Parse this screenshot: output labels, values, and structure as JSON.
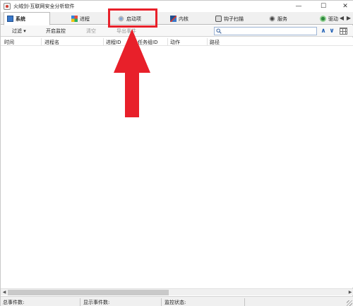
{
  "window": {
    "title": "火绒剑-互联网安全分析软件",
    "minimize": "—",
    "maximize": "☐",
    "close": "✕"
  },
  "tabs": [
    {
      "label": "系统",
      "icon": "monitor-icon",
      "active": true
    },
    {
      "label": "进程",
      "icon": "windows-flag-icon",
      "active": false
    },
    {
      "label": "启动项",
      "icon": "disc-icon",
      "active": false
    },
    {
      "label": "内核",
      "icon": "kernel-icon",
      "active": false
    },
    {
      "label": "钩子扫描",
      "icon": "hook-icon",
      "active": false
    },
    {
      "label": "服务",
      "icon": "gear-icon",
      "active": false
    },
    {
      "label": "驱动",
      "icon": "driver-icon",
      "active": false
    }
  ],
  "tab_scroll": {
    "left": "◀",
    "right": "▶"
  },
  "toolbar": {
    "filter_label": "过滤 ▾",
    "start_monitor_label": "开启监控",
    "clear_label": "清空",
    "export_label": "导出事件",
    "search_value": "",
    "search_placeholder": "",
    "nav_up": "∧",
    "nav_down": "∨"
  },
  "columns": [
    "时间",
    "进程名",
    "进程ID",
    "任务组ID",
    "动作",
    "路径"
  ],
  "status": {
    "total_events": "总事件数:",
    "shown_events": "显示事件数:",
    "monitor_state": "监控状态:"
  },
  "colors": {
    "annotation": "#e8202a",
    "accent": "#1f5fb5"
  }
}
